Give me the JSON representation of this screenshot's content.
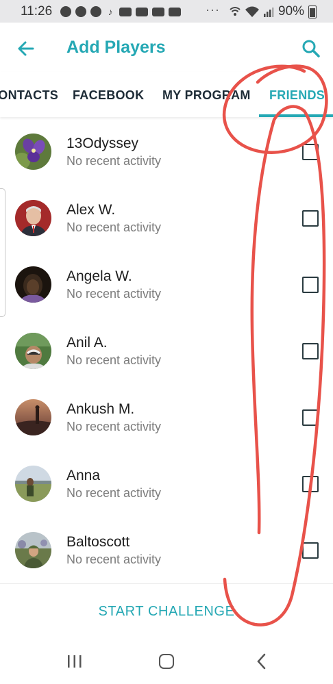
{
  "status_bar": {
    "time": "11:26",
    "battery_text": "90%",
    "overflow": "···"
  },
  "header": {
    "title": "Add Players"
  },
  "tabs": [
    {
      "label": "CONTACTS"
    },
    {
      "label": "FACEBOOK"
    },
    {
      "label": "MY PROGRAM"
    },
    {
      "label": "FRIENDS",
      "active": true
    }
  ],
  "friends": [
    {
      "name": "13Odyssey",
      "activity": "No recent activity",
      "avatar": "purple-flower",
      "checked": false
    },
    {
      "name": "Alex W.",
      "activity": "No recent activity",
      "avatar": "man-portrait",
      "checked": false
    },
    {
      "name": "Angela W.",
      "activity": "No recent activity",
      "avatar": "dark-portrait",
      "checked": false
    },
    {
      "name": "Anil A.",
      "activity": "No recent activity",
      "avatar": "man-outdoors",
      "checked": false
    },
    {
      "name": "Ankush M.",
      "activity": "No recent activity",
      "avatar": "sunset-silhouette",
      "checked": false
    },
    {
      "name": "Anna",
      "activity": "No recent activity",
      "avatar": "woman-field",
      "checked": false
    },
    {
      "name": "Baltoscott",
      "activity": "No recent activity",
      "avatar": "man-cap",
      "checked": false
    }
  ],
  "actions": {
    "start_challenge": "START CHALLENGE"
  },
  "colors": {
    "accent": "#25a8b4",
    "status_bar_bg": "#e8e8ea",
    "annotation": "#e8524a"
  }
}
